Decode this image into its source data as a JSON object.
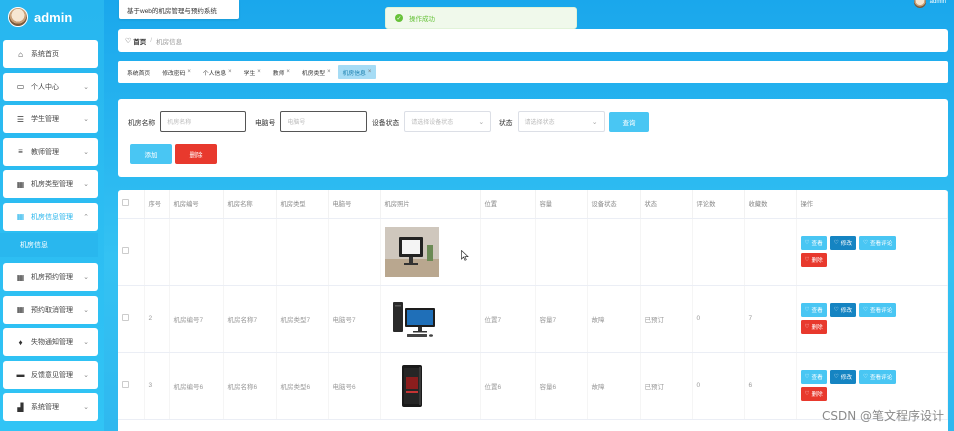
{
  "brand": {
    "name": "admin"
  },
  "topbar": {
    "system_title": "基于web的机房管理与预约系统",
    "toast": "操作成功",
    "user": "admin"
  },
  "sidebar": {
    "items": [
      {
        "label": "系统首页",
        "icon": "home-icon",
        "has_chevron": false
      },
      {
        "label": "个人中心",
        "icon": "calendar-icon",
        "has_chevron": true
      },
      {
        "label": "学生管理",
        "icon": "sliders-icon",
        "has_chevron": true
      },
      {
        "label": "教师管理",
        "icon": "list-icon",
        "has_chevron": true
      },
      {
        "label": "机房类型管理",
        "icon": "grid-icon",
        "has_chevron": true
      },
      {
        "label": "机房信息管理",
        "icon": "grid-icon",
        "has_chevron": true,
        "open": true
      },
      {
        "label": "机房预约管理",
        "icon": "grid-icon",
        "has_chevron": true
      },
      {
        "label": "预约取消管理",
        "icon": "grid-icon",
        "has_chevron": true
      },
      {
        "label": "失物通知管理",
        "icon": "pin-icon",
        "has_chevron": true
      },
      {
        "label": "反馈意见管理",
        "icon": "pc-icon",
        "has_chevron": true
      },
      {
        "label": "系统管理",
        "icon": "chart-icon",
        "has_chevron": true
      }
    ],
    "submenu": "机房信息"
  },
  "breadcrumb": {
    "home": "首页",
    "current": "机房信息"
  },
  "tags": [
    {
      "label": "系统首页",
      "closable": false,
      "active": false
    },
    {
      "label": "修改密码",
      "closable": true,
      "active": false
    },
    {
      "label": "个人信息",
      "closable": true,
      "active": false
    },
    {
      "label": "学生",
      "closable": true,
      "active": false
    },
    {
      "label": "教师",
      "closable": true,
      "active": false
    },
    {
      "label": "机房类型",
      "closable": true,
      "active": false
    },
    {
      "label": "机房信息",
      "closable": true,
      "active": true
    }
  ],
  "search": {
    "name_label": "机房名称",
    "name_placeholder": "机房名称",
    "pc_label": "电脑号",
    "pc_placeholder": "电脑号",
    "device_label": "设备状态",
    "device_placeholder": "请选择设备状态",
    "status_label": "状态",
    "status_placeholder": "请选择状态",
    "query_label": "查询",
    "add_label": "添加",
    "delete_label": "删除"
  },
  "table": {
    "headers": [
      "序号",
      "机房编号",
      "机房名称",
      "机房类型",
      "电脑号",
      "机房照片",
      "位置",
      "容量",
      "设备状态",
      "状态",
      "评论数",
      "收藏数",
      "操作"
    ],
    "rows": [
      {
        "index": "",
        "code": "",
        "name": "",
        "type": "",
        "pc": "",
        "photo": "monitor",
        "location": "",
        "capacity": "",
        "device": "",
        "status": "",
        "comments": "",
        "favorites": ""
      },
      {
        "index": "2",
        "code": "机房编号7",
        "name": "机房名称7",
        "type": "机房类型7",
        "pc": "电脑号7",
        "photo": "desktop",
        "location": "位置7",
        "capacity": "容量7",
        "device": "故障",
        "status": "已预订",
        "comments": "0",
        "favorites": "7"
      },
      {
        "index": "3",
        "code": "机房编号6",
        "name": "机房名称6",
        "type": "机房类型6",
        "pc": "电脑号6",
        "photo": "tower",
        "location": "位置6",
        "capacity": "容量6",
        "device": "故障",
        "status": "已预订",
        "comments": "0",
        "favorites": "6"
      }
    ],
    "ops": {
      "view": "查看",
      "edit": "修改",
      "review": "查看评论",
      "delete": "删除"
    }
  },
  "watermark": "CSDN @笔文程序设计"
}
